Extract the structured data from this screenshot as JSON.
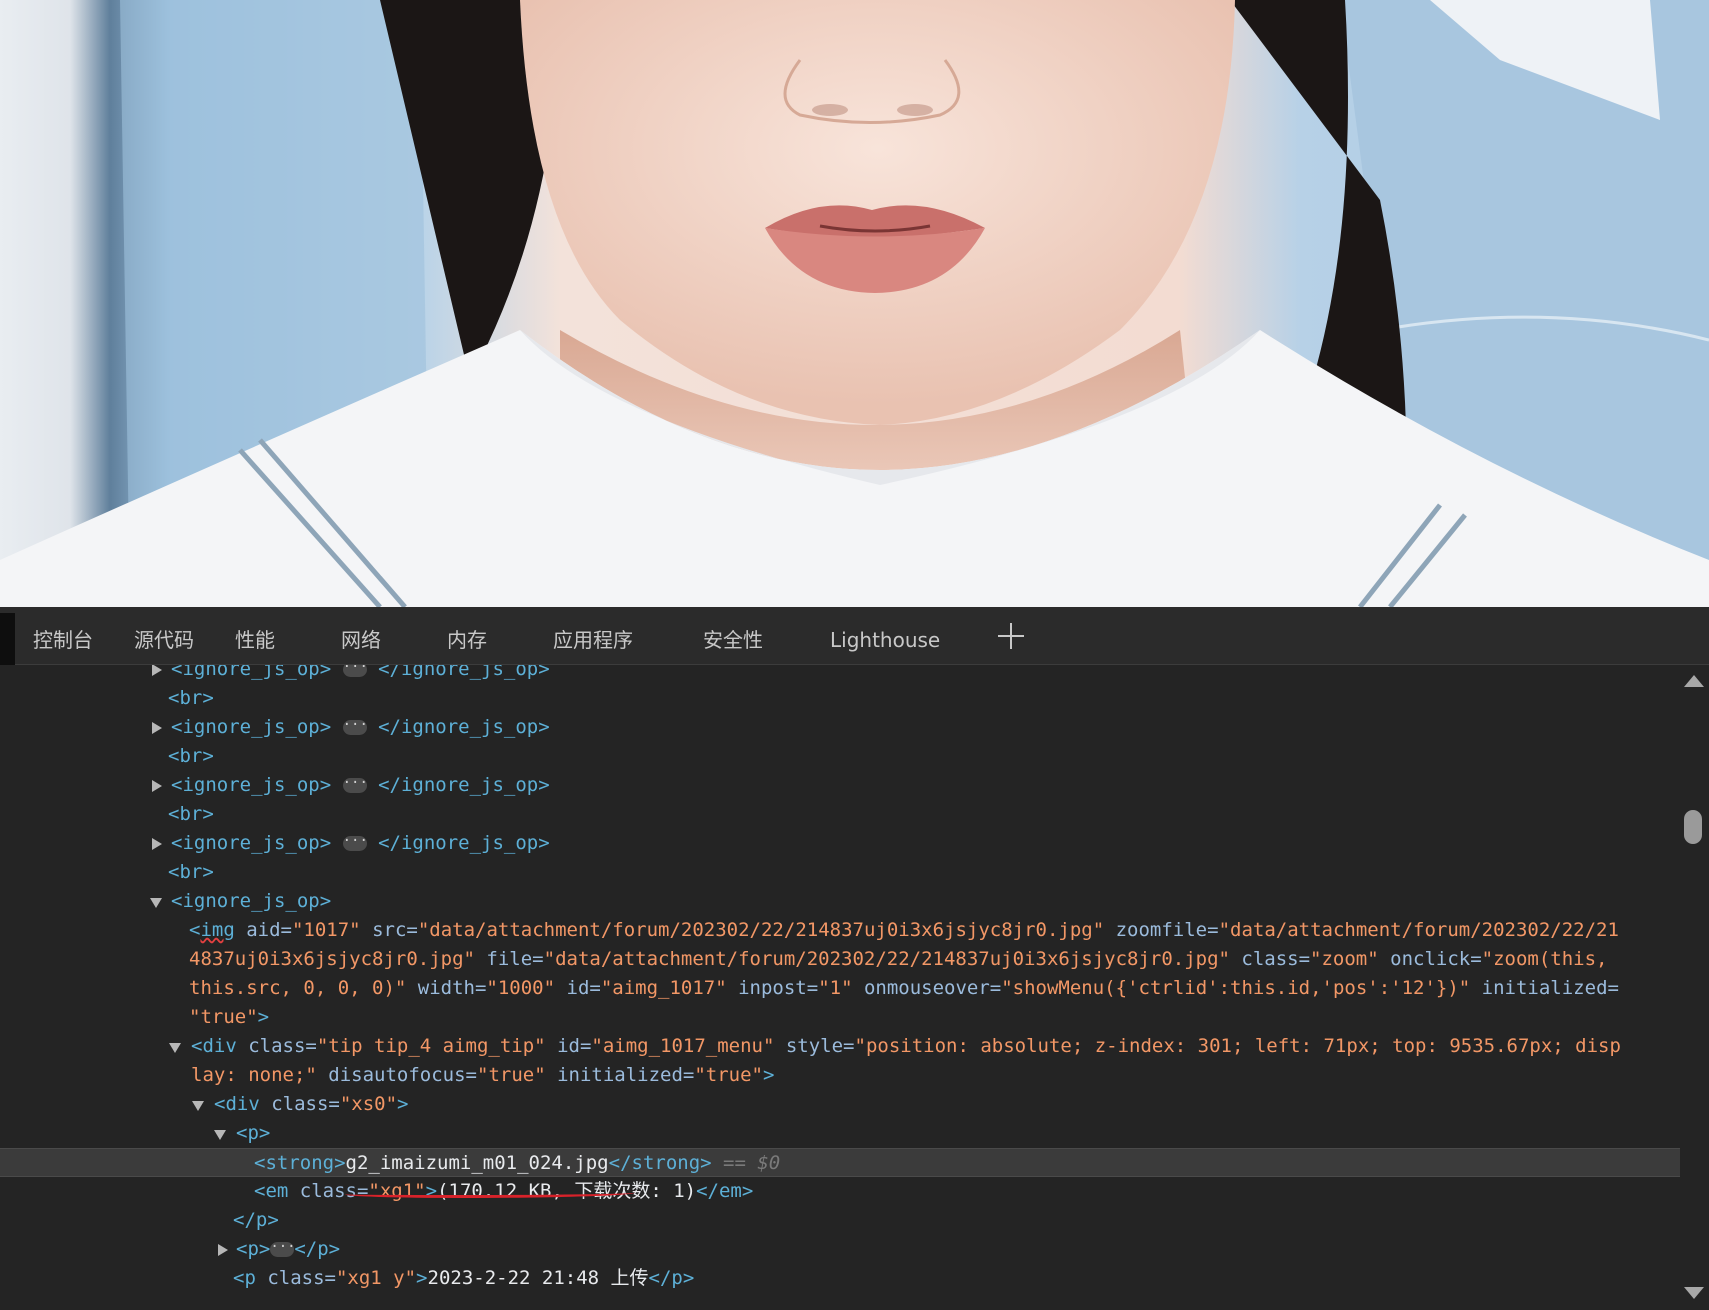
{
  "tabs": [
    "控制台",
    "源代码",
    "性能",
    "网络",
    "内存",
    "应用程序",
    "安全性",
    "Lighthouse"
  ],
  "tree": {
    "ignore_open": "<ignore_js_op>",
    "ignore_close": "</ignore_js_op>",
    "br": "<br>",
    "ellipsis": "···",
    "img_line1": {
      "open": "<",
      "tag": "img",
      "a1n": " aid=",
      "a1v": "\"1017\"",
      "a2n": " src=",
      "a2v": "\"data/attachment/forum/202302/22/214837uj0i3x6jsjyc8jr0.jpg\"",
      "a3n": " zoomfile=",
      "a3v": "\"data/attachment/forum/202302/22/21"
    },
    "img_line2": {
      "a3v": "4837uj0i3x6jsjyc8jr0.jpg\"",
      "a4n": " file=",
      "a4v": "\"data/attachment/forum/202302/22/214837uj0i3x6jsjyc8jr0.jpg\"",
      "a5n": " class=",
      "a5v": "\"zoom\"",
      "a6n": " onclick=",
      "a6v": "\"zoom(this,"
    },
    "img_line3": {
      "a6v": "this.src, 0, 0, 0)\"",
      "a7n": " width=",
      "a7v": "\"1000\"",
      "a8n": " id=",
      "a8v": "\"aimg_1017\"",
      "a9n": " inpost=",
      "a9v": "\"1\"",
      "a10n": " onmouseover=",
      "a10v": "\"showMenu({'ctrlid':this.id,'pos':'12'})\"",
      "a11n": " initialized="
    },
    "img_line4": {
      "a11v": "\"true\"",
      "close": ">"
    },
    "div_line1": {
      "open": "<div",
      "a1n": " class=",
      "a1v": "\"tip tip_4 aimg_tip\"",
      "a2n": " id=",
      "a2v": "\"aimg_1017_menu\"",
      "a3n": " style=",
      "a3v": "\"position: absolute; z-index: 301; left: 71px; top: 9535.67px; disp"
    },
    "div_line2": {
      "a3v": "lay: none;\"",
      "a4n": " disautofocus=",
      "a4v": "\"true\"",
      "a5n": " initialized=",
      "a5v": "\"true\"",
      "close": ">"
    },
    "xs0": {
      "open": "<div",
      "an": " class=",
      "av": "\"xs0\"",
      "close": ">"
    },
    "p_open": "<p>",
    "p_close": "</p>",
    "strong": {
      "open": "<strong>",
      "text": "g2_imaizumi_m01_024.jpg",
      "close": "</strong>",
      "marker": " == $0"
    },
    "em": {
      "open": "<em",
      "an": " class=",
      "av": "\"xg1\"",
      "close": ">",
      "text": "(170.12 KB, 下载次数: 1)",
      "end": "</em>"
    },
    "p_last": {
      "open": "<p",
      "an": " class=",
      "av": "\"xg1 y\"",
      "close": ">",
      "text": "2023-2-22 21:48 上传",
      "end": "</p>"
    }
  }
}
